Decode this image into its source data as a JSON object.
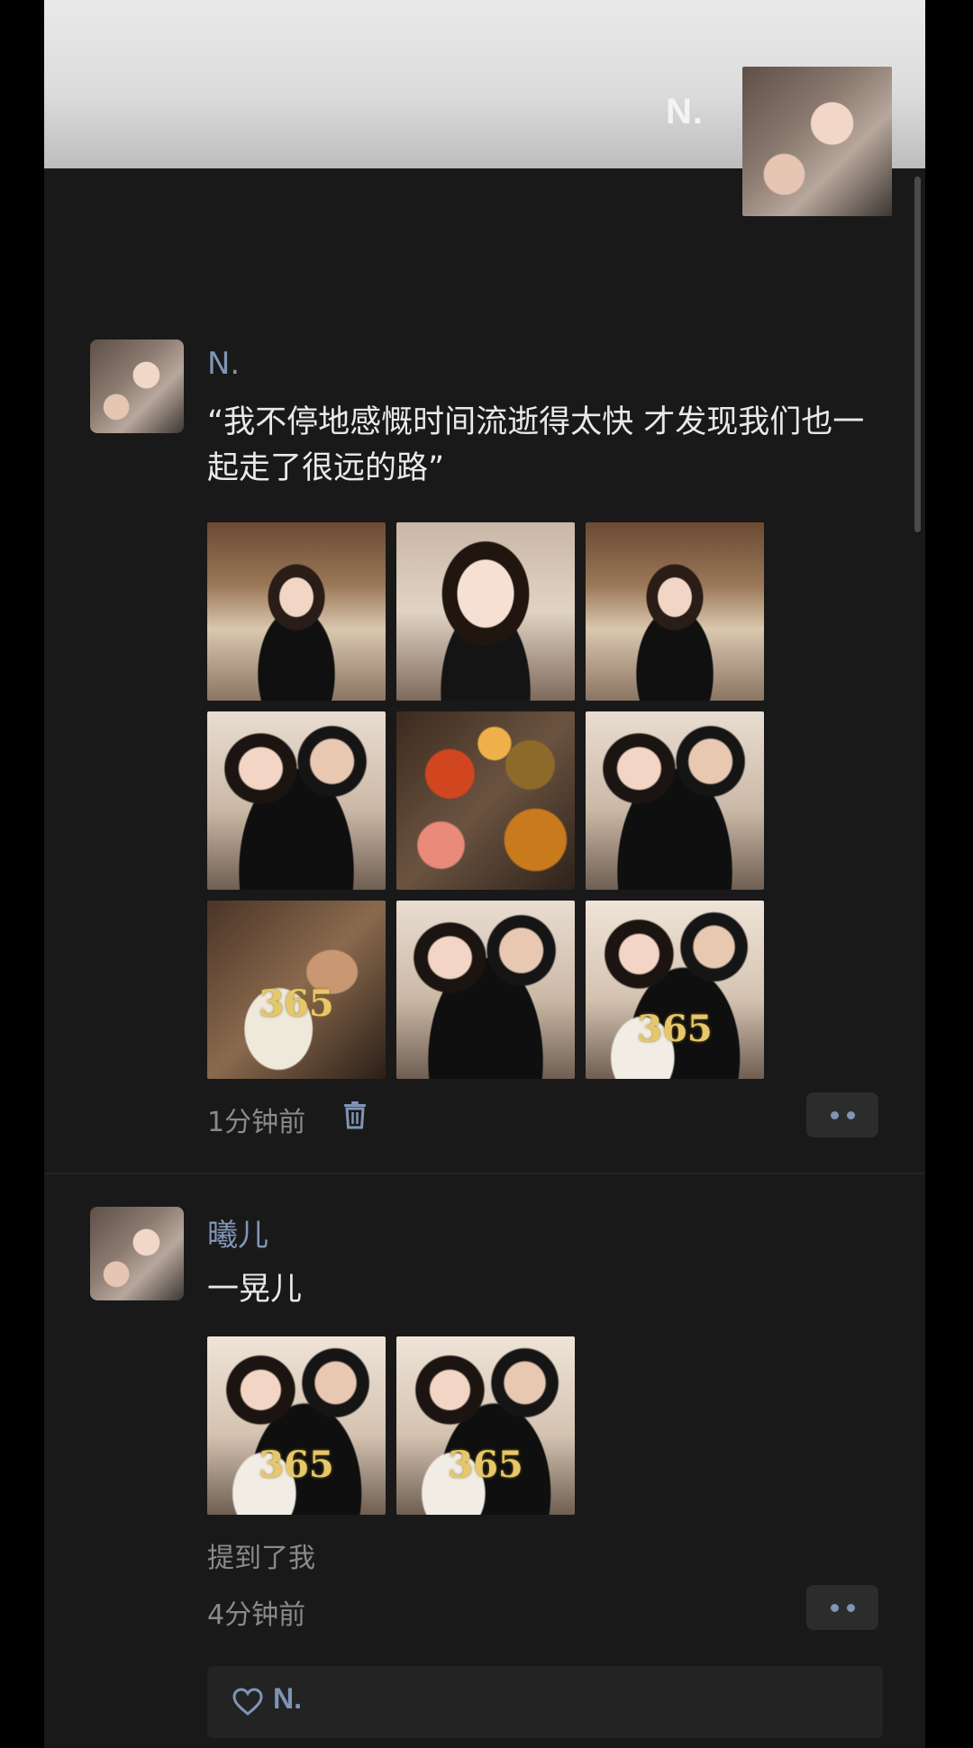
{
  "cover": {
    "name": "N."
  },
  "posts": [
    {
      "author": "N.",
      "text": "“我不停地感慨时间流逝得太快 才发现我们也一起走了很远的路”",
      "photos": [
        "dining-selfie",
        "close-up-selfie",
        "dining-selfie",
        "couple-selfie",
        "food-spread",
        "couple-selfie",
        "birthday-cake",
        "couple-selfie",
        "couple-cake-selfie"
      ],
      "cake_number": "365",
      "time": "1分钟前"
    },
    {
      "author": "曦儿",
      "text": "一晃儿",
      "photos": [
        "couple-cake-selfie",
        "couple-cake-selfie"
      ],
      "cake_number": "365",
      "mention": "提到了我",
      "time": "4分钟前"
    }
  ],
  "likes": {
    "names": "N."
  },
  "colors": {
    "accent": "#7f95b5",
    "background": "#191919"
  },
  "icons": {
    "trash": "trash-icon",
    "more": "more-dots-icon",
    "like": "heart-outline-icon"
  }
}
